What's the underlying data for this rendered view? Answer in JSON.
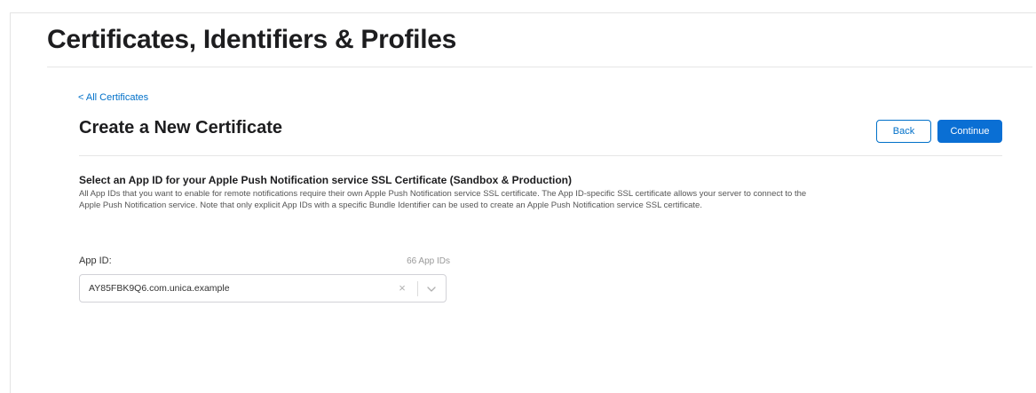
{
  "header": {
    "title": "Certificates, Identifiers & Profiles"
  },
  "breadcrumb": {
    "back_link": "< All Certificates"
  },
  "main": {
    "section_title": "Create a New Certificate",
    "back_button": "Back",
    "continue_button": "Continue",
    "description_heading": "Select an App ID for your Apple Push Notification service SSL Certificate (Sandbox & Production)",
    "description_body": "All App IDs that you want to enable for remote notifications require their own Apple Push Notification service SSL certificate. The App ID-specific SSL certificate allows your server to connect to the Apple Push Notification service. Note that only explicit App IDs with a specific Bundle Identifier can be used to create an Apple Push Notification service SSL certificate.",
    "app_id_field": {
      "label": "App ID:",
      "count": "66 App IDs",
      "value": "AY85FBK9Q6.com.unica.example",
      "clear_glyph": "×"
    }
  },
  "icons": {
    "clear": "close-icon",
    "dropdown": "chevron-down-icon"
  },
  "colors": {
    "accent": "#0070c9",
    "primary_button": "#0a6fd4"
  }
}
